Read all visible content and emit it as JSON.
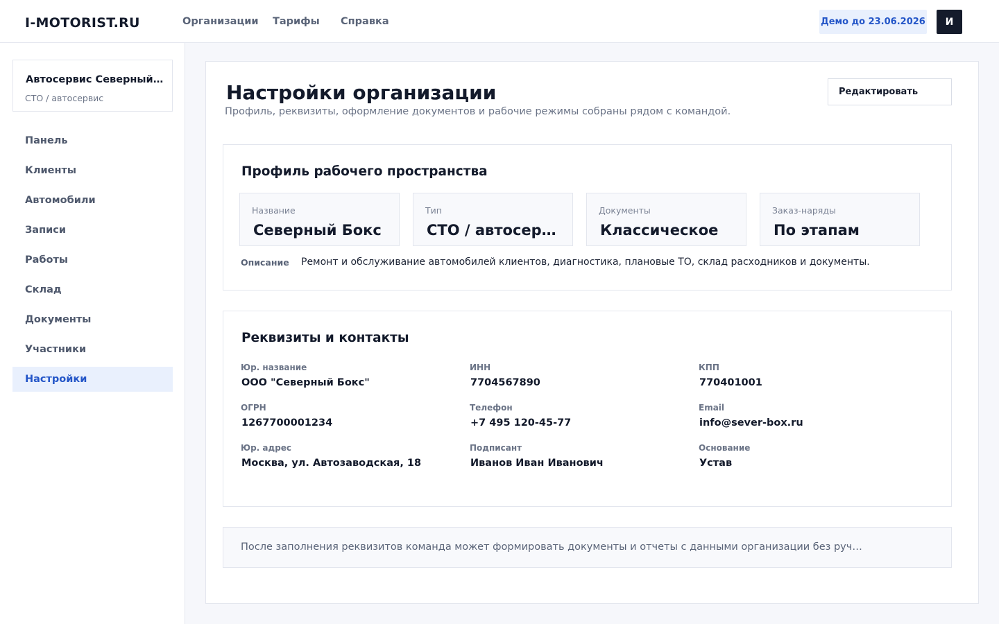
{
  "header": {
    "logo": "I-MOTORIST.RU",
    "nav": [
      "Организации",
      "Тарифы",
      "Справка"
    ],
    "demo_badge": "Демо до 23.06.2026",
    "avatar_initial": "И"
  },
  "sidebar": {
    "org_name": "Автосервис  Северный Бокс",
    "org_type": "СТО / автосервис",
    "items": [
      {
        "label": "Панель"
      },
      {
        "label": "Клиенты"
      },
      {
        "label": "Автомобили"
      },
      {
        "label": "Записи"
      },
      {
        "label": "Работы"
      },
      {
        "label": "Склад"
      },
      {
        "label": "Документы"
      },
      {
        "label": "Участники"
      },
      {
        "label": "Настройки",
        "active": true
      }
    ]
  },
  "main": {
    "title": "Настройки организации",
    "subtitle": "Профиль, реквизиты, оформление документов и рабочие режимы собраны рядом с командой.",
    "edit_label": "Редактировать",
    "profile": {
      "title": "Профиль рабочего пространства",
      "stats": [
        {
          "label": "Название",
          "value": "Северный Бокс"
        },
        {
          "label": "Тип",
          "value": "СТО / автосервис"
        },
        {
          "label": "Документы",
          "value": "Классическое"
        },
        {
          "label": "Заказ-наряды",
          "value": "По этапам"
        }
      ],
      "description_label": "Описание",
      "description": "Ремонт и обслуживание автомобилей клиентов, диагностика, плановые ТО, склад расходников и документы."
    },
    "requisites": {
      "title": "Реквизиты и контакты",
      "fields": [
        {
          "label": "Юр. название",
          "value": "ООО \"Северный Бокс\""
        },
        {
          "label": "ИНН",
          "value": "7704567890"
        },
        {
          "label": "КПП",
          "value": "770401001"
        },
        {
          "label": "ОГРН",
          "value": "1267700001234"
        },
        {
          "label": "Телефон",
          "value": "+7 495 120-45-77"
        },
        {
          "label": "Email",
          "value": "info@sever-box.ru"
        },
        {
          "label": "Юр. адрес",
          "value": "Москва, ул. Автозаводская, 18"
        },
        {
          "label": "Подписант",
          "value": "Иванов Иван Иванович"
        },
        {
          "label": "Основание",
          "value": "Устав"
        }
      ]
    },
    "note": "После заполнения реквизитов команда может формировать документы и отчеты с данными организации без ручного переноса."
  },
  "colors": {
    "accent": "#2456c8",
    "accent_bg": "#e9f0fd",
    "dark": "#141b2b",
    "page_bg": "#f6f7fb"
  }
}
